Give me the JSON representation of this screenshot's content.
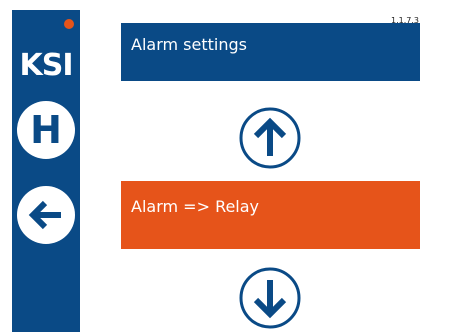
{
  "version": "1.1.7.3",
  "logo": "KSI",
  "sidebar": {
    "home_label": "H",
    "home_icon": "home-icon",
    "back_icon": "arrow-left-icon"
  },
  "menu": {
    "items": [
      {
        "label": "Alarm settings",
        "selected": false
      },
      {
        "label": "Alarm => Relay",
        "selected": true
      }
    ]
  },
  "nav": {
    "up_icon": "arrow-up-icon",
    "down_icon": "arrow-down-icon"
  },
  "colors": {
    "brand_blue": "#0a4a86",
    "accent_orange": "#e6541a"
  }
}
